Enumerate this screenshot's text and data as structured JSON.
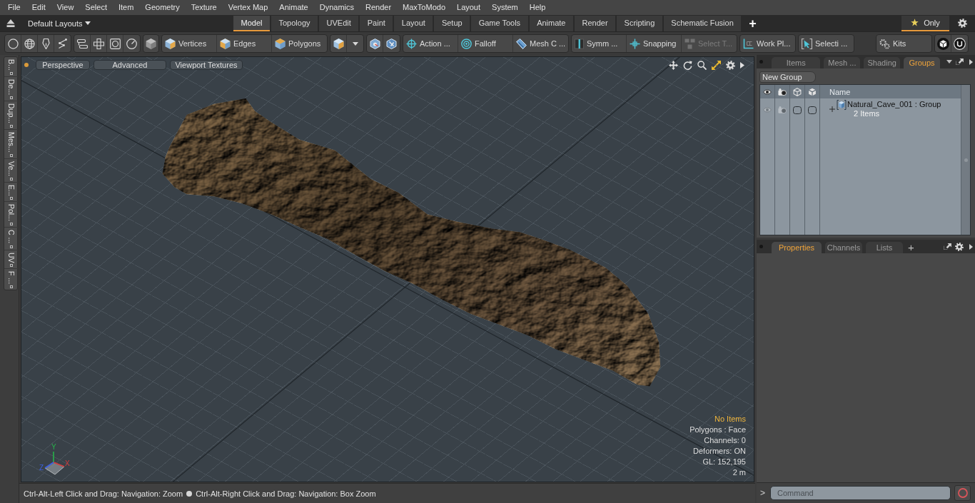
{
  "menu_bar": {
    "items": [
      "File",
      "Edit",
      "View",
      "Select",
      "Item",
      "Geometry",
      "Texture",
      "Vertex Map",
      "Animate",
      "Dynamics",
      "Render",
      "MaxToModo",
      "Layout",
      "System",
      "Help"
    ]
  },
  "layout_bar": {
    "layouts_menu": "Default Layouts",
    "tabs": [
      {
        "label": "Model",
        "selected": true
      },
      {
        "label": "Topology",
        "selected": false
      },
      {
        "label": "UVEdit",
        "selected": false
      },
      {
        "label": "Paint",
        "selected": false
      },
      {
        "label": "Layout",
        "selected": false
      },
      {
        "label": "Setup",
        "selected": false
      },
      {
        "label": "Game Tools",
        "selected": false
      },
      {
        "label": "Animate",
        "selected": false
      },
      {
        "label": "Render",
        "selected": false
      },
      {
        "label": "Scripting",
        "selected": false
      },
      {
        "label": "Schematic Fusion",
        "selected": false
      }
    ],
    "add_tab": "+",
    "filter_tab": {
      "label": "Only",
      "selected": true
    }
  },
  "toolbar": {
    "component_modes": [
      {
        "label": "Vertices",
        "disabled": false
      },
      {
        "label": "Edges",
        "disabled": false
      },
      {
        "label": "Polygons",
        "disabled": false
      }
    ],
    "action_tools": [
      {
        "label": "Action ...",
        "disabled": false
      },
      {
        "label": "Falloff",
        "disabled": false
      },
      {
        "label": "Mesh C ...",
        "disabled": false
      }
    ],
    "mode_toggles": [
      {
        "label": "Symm ...",
        "disabled": false
      },
      {
        "label": "Snapping",
        "disabled": false
      },
      {
        "label": "Select T...",
        "disabled": true
      }
    ],
    "extra_tools": [
      {
        "label": "Work Pl...",
        "disabled": false
      },
      {
        "label": "Selecti ...",
        "disabled": false
      }
    ],
    "kits": {
      "label": "Kits"
    }
  },
  "left_toolbox": {
    "tabs": [
      "B...",
      "De...",
      "Dup...",
      "Mes...",
      "Ve...",
      "E...",
      "Pol...",
      "C ...",
      "UV",
      "F ..."
    ]
  },
  "viewport": {
    "header_buttons": [
      "Perspective",
      "Advanced",
      "Viewport Textures"
    ],
    "axis_labels": [
      "Y",
      "X",
      "Z"
    ],
    "stats": [
      {
        "text": "No Items",
        "kind": "selection"
      },
      {
        "text": "Polygons : Face",
        "kind": "info"
      },
      {
        "text": "Channels: 0",
        "kind": "info"
      },
      {
        "text": "Deformers: ON",
        "kind": "info"
      },
      {
        "text": "GL: 152,195",
        "kind": "info"
      },
      {
        "text": "2 m",
        "kind": "info"
      }
    ]
  },
  "status_bar": {
    "hints": [
      "Ctrl-Alt-Left Click and Drag: Navigation: Zoom",
      "Ctrl-Alt-Right Click and Drag: Navigation: Box Zoom"
    ]
  },
  "groups_panel": {
    "tabs": [
      {
        "label": "Items",
        "selected": false
      },
      {
        "label": "Mesh ...",
        "selected": false
      },
      {
        "label": "Shading",
        "selected": false
      },
      {
        "label": "Groups",
        "selected": true
      }
    ],
    "new_group_button": "New Group",
    "name_column": "Name",
    "rows": [
      {
        "name": "Natural_Cave_001 : Group",
        "count": "2 Items",
        "expanded": false
      }
    ]
  },
  "properties_panel": {
    "tabs": [
      {
        "label": "Properties",
        "selected": true
      },
      {
        "label": "Channels",
        "selected": false
      },
      {
        "label": "Lists",
        "selected": false
      }
    ],
    "add_tab": "+"
  },
  "command_bar": {
    "prompt": ">",
    "placeholder": "Command"
  }
}
